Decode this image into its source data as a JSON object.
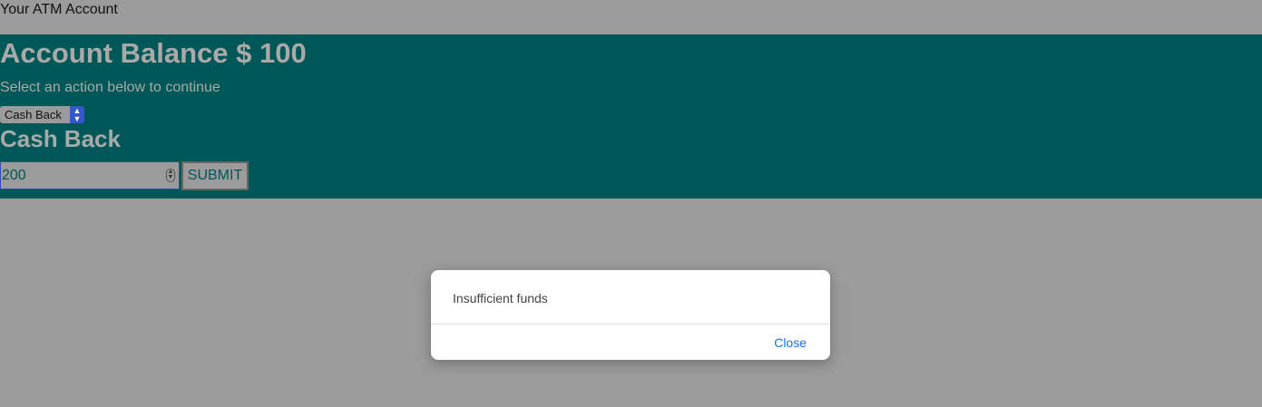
{
  "header": {
    "title": "Your ATM Account"
  },
  "account": {
    "balance_text": "Account Balance $ 100",
    "instruction": "Select an action below to continue"
  },
  "action_select": {
    "selected": "Cash Back",
    "arrow_icon": "updown-chevron-icon"
  },
  "section": {
    "heading": "Cash Back"
  },
  "form": {
    "amount_value": "200",
    "submit_label": "SUBMIT"
  },
  "dialog": {
    "message": "Insufficient funds",
    "close_label": "Close"
  },
  "colors": {
    "panel": "#005757",
    "overlay": "#9b9b9b",
    "link": "#1a73e8"
  }
}
